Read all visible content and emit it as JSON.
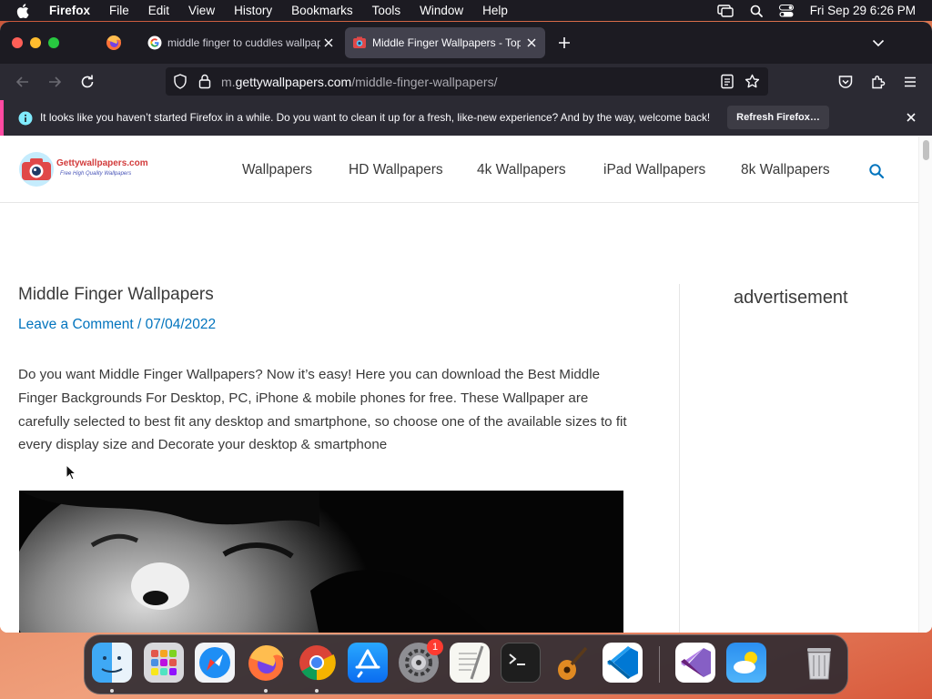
{
  "menubar": {
    "app_name": "Firefox",
    "items": [
      "File",
      "Edit",
      "View",
      "History",
      "Bookmarks",
      "Tools",
      "Window",
      "Help"
    ],
    "clock": "Fri Sep 29  6:26 PM"
  },
  "browser": {
    "tabs": [
      {
        "title": "middle finger to cuddles wallpap",
        "favicon": "google-icon",
        "active": false
      },
      {
        "title": "Middle Finger Wallpapers - Top",
        "favicon": "gettywallpapers-icon",
        "active": true
      }
    ],
    "url": {
      "prefix": "m.",
      "host": "gettywallpapers.com",
      "path": "/middle-finger-wallpapers/"
    },
    "notification": {
      "message": "It looks like you haven’t started Firefox in a while. Do you want to clean it up for a fresh, like-new experience? And by the way, welcome back!",
      "button": "Refresh Firefox…"
    }
  },
  "site": {
    "logo": {
      "brand": "Gettywallpapers.com",
      "tagline": "Free High Quality Wallpapers"
    },
    "nav": [
      "Wallpapers",
      "HD Wallpapers",
      "4k Wallpapers",
      "iPad Wallpapers",
      "8k Wallpapers"
    ],
    "accent_color": "#0274be"
  },
  "article": {
    "title": "Middle Finger Wallpapers",
    "meta": "Leave a Comment / 07/04/2022",
    "body": "Do you want Middle Finger Wallpapers? Now it’s easy! Here you can download the Best Middle Finger Backgrounds For Desktop, PC, iPhone & mobile phones for free. These Wallpaper are carefully selected to best fit any desktop and smartphone, so choose one of the available sizes to fit every display size and Decorate your desktop & smartphone"
  },
  "sidebar": {
    "title": "advertisement"
  },
  "dock": {
    "apps": [
      "Finder",
      "Launchpad",
      "Safari",
      "Firefox",
      "Chrome",
      "App Store",
      "System Settings",
      "TextEdit",
      "Terminal",
      "GarageBand",
      "Visual Studio Code",
      "Visual Studio",
      "Weather",
      "Trash"
    ],
    "settings_badge": "1"
  }
}
